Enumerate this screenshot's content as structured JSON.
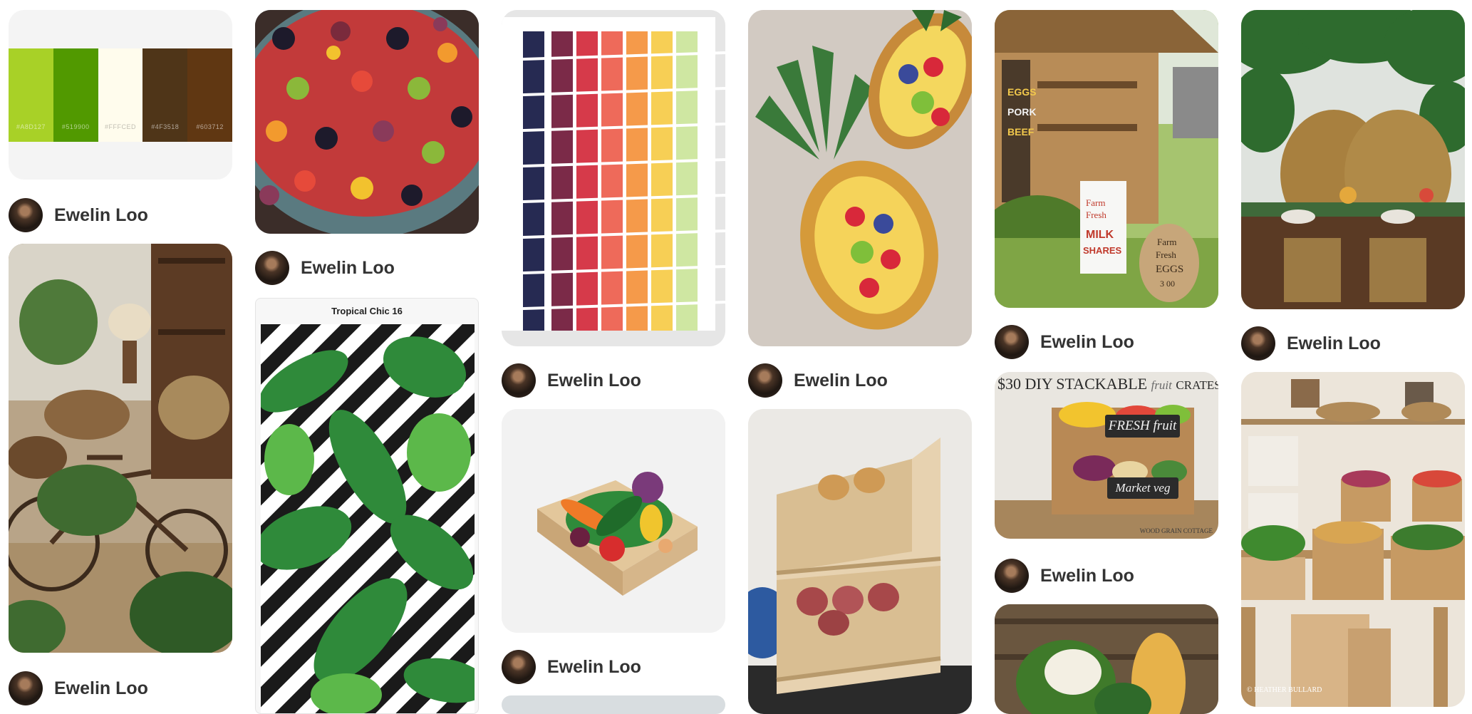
{
  "author": {
    "name": "Ewelin Loo"
  },
  "palette": {
    "swatches": [
      {
        "hex": "#A8D127",
        "label": "#A8D127"
      },
      {
        "hex": "#519900",
        "label": "#519900"
      },
      {
        "hex": "#FFFCED",
        "label": "#FFFCED"
      },
      {
        "hex": "#4F3518",
        "label": "#4F3518"
      },
      {
        "hex": "#603712",
        "label": "#603712"
      }
    ]
  },
  "pins": {
    "palette": {
      "alt": "Green and brown color palette"
    },
    "fruit_salad": {
      "alt": "Bowl of mixed fruit salad"
    },
    "rainbow_skewers": {
      "alt": "Rainbow fruit skewers"
    },
    "pineapple_boats": {
      "alt": "Fruit-filled pineapple boats"
    },
    "farm_stand": {
      "alt": "Wooden farm stand",
      "sign_words": [
        "EGGS",
        "PORK",
        "BEEF"
      ],
      "milk_sign": [
        "Farm",
        "Fresh",
        "MILK",
        "SHARES"
      ],
      "eggs_sign": [
        "Farm",
        "Fresh",
        "EGGS",
        "3 00"
      ]
    },
    "tropical_table": {
      "alt": "Tropical table setting"
    },
    "bicycle_room": {
      "alt": "Rattan decor with bicycle"
    },
    "pattern": {
      "title": "Tropical Chic 16",
      "alt": "Tropical leaf pattern"
    },
    "toy_veggies": {
      "alt": "Toy vegetables in a crate"
    },
    "stacked_bins": {
      "alt": "Stacked wooden produce bins"
    },
    "diy_crates": {
      "headline": "$30 DIY STACKABLE",
      "headline_end": "CRATES",
      "sign_top": "FRESH fruit",
      "sign_bottom": "Market veg",
      "watermark": "WOOD GRAIN COTTAGE"
    },
    "market_display": {
      "alt": "Market produce display",
      "watermark": "© HEATHER BULLARD"
    },
    "cauliflower": {
      "alt": "Cauliflower and squash"
    }
  }
}
